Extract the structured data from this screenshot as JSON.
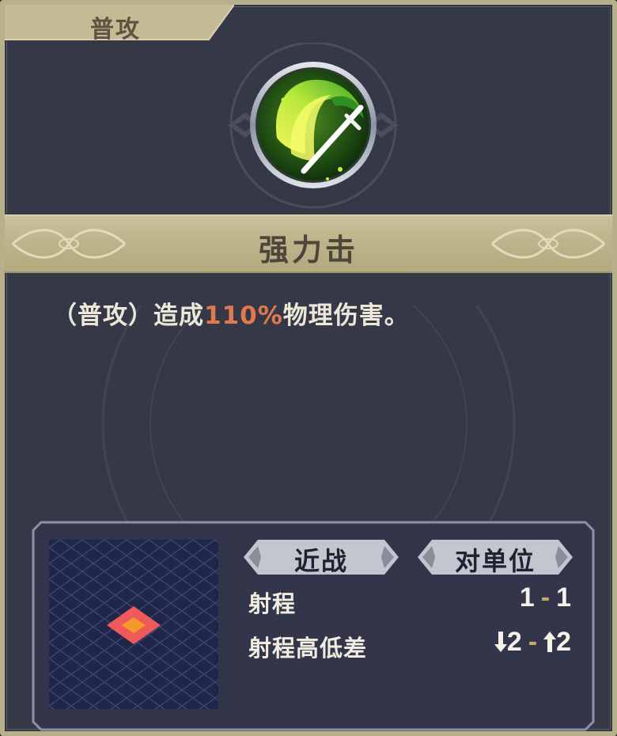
{
  "category_tab": {
    "label": "普攻"
  },
  "skill": {
    "name": "强力击",
    "description": {
      "prefix": "（普攻）造成",
      "highlight": "110%",
      "suffix": "物理伤害。"
    },
    "icon": "green-sword-slash-icon"
  },
  "info": {
    "attack_type": "近战",
    "target_type": "对单位",
    "range": {
      "label": "射程",
      "min": "1",
      "sep": "-",
      "max": "1"
    },
    "height_diff": {
      "label": "射程高低差",
      "down": "2",
      "sep": "-",
      "up": "2"
    }
  },
  "colors": {
    "frame_gold": "#b8b08a",
    "panel_bg": "#353846",
    "highlight": "#e07a4e",
    "grid_bg": "#1f2648",
    "range_red": "#f05a5a",
    "range_center": "#f59a2a"
  }
}
